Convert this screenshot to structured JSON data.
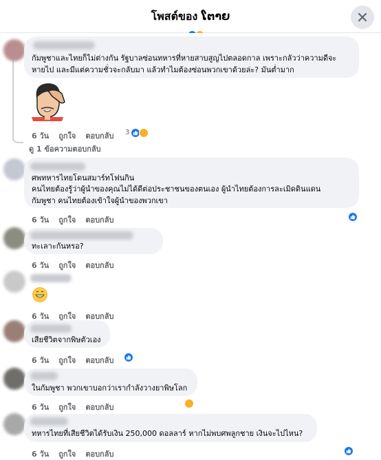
{
  "header": {
    "title": "โพสต์ของ ໂຕາຍ"
  },
  "comments": [
    {
      "lines": [
        "กัมพูชาและไทยก็ไม่ต่างกัน รัฐบาลซ่อนทหารที่หายสาบสูญไปตลอดกาล เพราะกลัวว่าความดีจะ",
        "หายไป และมีแต่ความชั่วจะกลับมา แล้วทำไมต้องซ่อนพวกเขาด้วยล่ะ? มันต่ำมาก"
      ],
      "time": "6 วัน",
      "like": "ถูกใจ",
      "reply": "ตอบกลับ",
      "reaction_count": "3"
    },
    {
      "lines": [
        "ศพทหารไทยโดนสมาร์ทโฟนกิน",
        "คนไทยต้องรู้ว่าผู้นำของคุณไม่ได้ดีต่อประชาชนของตนเอง ผู้นำไทยต้องการละเมิดดินแดน",
        "กัมพูชา คนไทยต้องเข้าใจผู้นำของพวกเขา"
      ],
      "time": "6 วัน",
      "like": "ถูกใจ",
      "reply": "ตอบกลับ"
    },
    {
      "lines": [
        "ทะเลาะกันหรอ?"
      ],
      "time": "6 วัน",
      "like": "ถูกใจ",
      "reply": "ตอบกลับ"
    },
    {
      "lines": [],
      "time": "6 วัน",
      "like": "ถูกใจ",
      "reply": "ตอบกลับ"
    },
    {
      "lines": [
        "เสียชีวิตจากพิษตัวเอง"
      ],
      "time": "6 วัน",
      "like": "ถูกใจ",
      "reply": "ตอบกลับ"
    },
    {
      "lines": [
        "ในกัมพูชา พวกเขาบอกว่าเรากำลังวางยาพิษโลก"
      ],
      "time": "6 วัน",
      "like": "ถูกใจ",
      "reply": "ตอบกลับ"
    },
    {
      "lines": [
        "ทหารไทยที่เสียชีวิตได้รับเงิน 250,000 ดอลลาร์ หากไม่พบศพลูกชาย เงินจะไปไหน?"
      ],
      "time": "6 วัน",
      "like": "ถูกใจ",
      "reply": "ตอบกลับ"
    }
  ],
  "view_replies": "ดู 1 ข้อความตอบกลับ",
  "icons": [
    "close-icon",
    "like-icon",
    "haha-icon",
    "grinning-emoji",
    "facepalm-sticker"
  ],
  "colors": {
    "like_blue": "#1877f2",
    "bubble": "#f0f2f5",
    "meta": "#65676b"
  }
}
